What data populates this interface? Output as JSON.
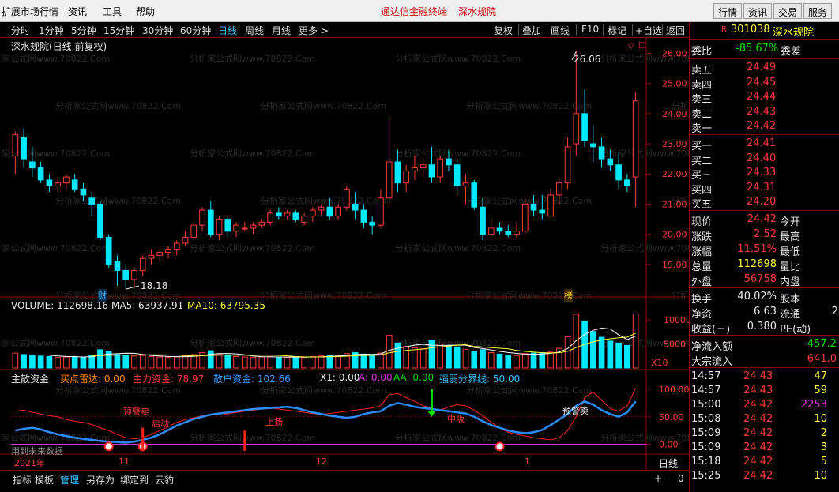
{
  "menu": {
    "left_items": [
      "扩展市场行情",
      "资讯",
      "工具",
      "帮助"
    ],
    "notice": "通达信金融终端",
    "notice2": "深水规院",
    "right_buttons": [
      "行情",
      "资讯",
      "交易",
      "服务"
    ]
  },
  "toolbar": {
    "periods": [
      "分时",
      "1分钟",
      "5分钟",
      "15分钟",
      "30分钟",
      "60分钟",
      "日线",
      "周线",
      "月线",
      "更多 >"
    ],
    "active_period": "日线",
    "right_buttons": [
      "复权",
      "叠加",
      "画线",
      "F10",
      "标记",
      "+自选",
      "返回"
    ]
  },
  "stock": {
    "title_label": "深水规院(日线,前复权)",
    "code": "301038",
    "name": "深水规院",
    "r_badge": "R"
  },
  "price_chart": {
    "y_ticks": [
      "26.00",
      "25.00",
      "24.00",
      "23.00",
      "22.00",
      "21.00",
      "20.00",
      "19.00"
    ],
    "high_annotation": "26.06",
    "low_annotation": "18.18",
    "marker_cai": "财",
    "marker_bang": "榜",
    "watermark": "分析家公式网www.70822.Com"
  },
  "volume_chart": {
    "volume_label": "VOLUME: 112698.16",
    "ma5_label": "MA5: 63937.91",
    "ma10_label": "MA10: 63795.35",
    "y_ticks": [
      "10000",
      "5000"
    ],
    "unit": "X10",
    "colors": {
      "up": "#ff3b3b",
      "down": "#00e8ff",
      "ma5": "#ffffff",
      "ma10": "#ffff3b"
    }
  },
  "indicator_chart": {
    "name": "主散资金",
    "buy_radar": "买点雷达: 0.00",
    "main_fund": "主力资金: 78.97",
    "retail_fund": "散户资金: 102.66",
    "x1": "X1: 0.00",
    "a": "A: 0.00",
    "aa": "AA: 0.00",
    "strong_weak": "强弱分界线: 50.00",
    "y_ticks": [
      "100.00",
      "50.00",
      "0.00"
    ],
    "annotations": {
      "warn_sell": "预警卖",
      "start": "启动",
      "rise": "上扬",
      "mid": "中阪",
      "warn_buy": "预警卖"
    },
    "future_data": "用到未来数据"
  },
  "xaxis": {
    "labels": [
      "2021年",
      "11",
      "12",
      "1"
    ],
    "period": "日线",
    "zoom": [
      "+",
      "-",
      "0"
    ]
  },
  "bottom": {
    "tabs": [
      "指标",
      "模板",
      "管理",
      "另存为",
      "绑定到",
      "云豹"
    ],
    "active_tab": "管理"
  },
  "quote": {
    "weibi": {
      "label": "委比",
      "value": "-85.67%",
      "label2": "委差"
    },
    "asks": [
      {
        "label": "卖五",
        "price": "24.49"
      },
      {
        "label": "卖四",
        "price": "24.45"
      },
      {
        "label": "卖三",
        "price": "24.44"
      },
      {
        "label": "卖二",
        "price": "24.43"
      },
      {
        "label": "卖一",
        "price": "24.42"
      }
    ],
    "bids": [
      {
        "label": "买一",
        "price": "24.41"
      },
      {
        "label": "买二",
        "price": "24.40"
      },
      {
        "label": "买三",
        "price": "24.33"
      },
      {
        "label": "买四",
        "price": "24.31"
      },
      {
        "label": "买五",
        "price": "24.20"
      }
    ],
    "stats": [
      {
        "l1": "现价",
        "v": "24.42",
        "l2": "今开",
        "vc": "red"
      },
      {
        "l1": "涨跌",
        "v": "2.52",
        "l2": "最高",
        "vc": "red"
      },
      {
        "l1": "涨幅",
        "v": "11.51%",
        "l2": "最低",
        "vc": "red"
      },
      {
        "l1": "总量",
        "v": "112698",
        "l2": "量比",
        "vc": "yellow"
      },
      {
        "l1": "外盘",
        "v": "56758",
        "l2": "内盘",
        "vc": "red"
      }
    ],
    "stats2": [
      {
        "l1": "换手",
        "v": "40.02%",
        "l2": "股本",
        "v2": ""
      },
      {
        "l1": "净资",
        "v": "6.63",
        "l2": "流通",
        "v2": "2"
      },
      {
        "l1": "收益(三)",
        "v": "0.380",
        "l2": "PE(动)",
        "v2": ""
      }
    ],
    "flows": [
      {
        "label": "净流入额",
        "value": "-457.2",
        "vc": "green"
      },
      {
        "label": "大宗流入",
        "value": "641.0",
        "vc": "red"
      }
    ],
    "ticks": [
      {
        "time": "14:57",
        "price": "24.43",
        "vol": "47",
        "vc": "yellow"
      },
      {
        "time": "14:57",
        "price": "24.43",
        "vol": "59",
        "vc": "yellow"
      },
      {
        "time": "15:00",
        "price": "24.42",
        "vol": "2253",
        "vc": "magenta"
      },
      {
        "time": "15:08",
        "price": "24.42",
        "vol": "10",
        "vc": "yellow"
      },
      {
        "time": "15:09",
        "price": "24.42",
        "vol": "2",
        "vc": "yellow"
      },
      {
        "time": "15:09",
        "price": "24.42",
        "vol": "3",
        "vc": "yellow"
      },
      {
        "time": "15:18",
        "price": "24.42",
        "vol": "5",
        "vc": "yellow"
      },
      {
        "time": "15:25",
        "price": "24.42",
        "vol": "10",
        "vc": "yellow"
      }
    ]
  },
  "candles": [
    [
      22.6,
      23.4,
      22.0,
      23.3
    ],
    [
      23.2,
      23.5,
      22.2,
      22.5
    ],
    [
      22.4,
      22.9,
      21.9,
      22.2
    ],
    [
      22.2,
      22.4,
      21.7,
      21.8
    ],
    [
      21.8,
      22.0,
      21.4,
      21.6
    ],
    [
      21.6,
      21.9,
      21.4,
      21.7
    ],
    [
      21.7,
      22.0,
      21.5,
      21.9
    ],
    [
      21.8,
      22.0,
      21.4,
      21.5
    ],
    [
      21.5,
      21.7,
      21.1,
      21.3
    ],
    [
      21.2,
      21.4,
      20.6,
      21.0
    ],
    [
      21.0,
      21.1,
      19.8,
      19.9
    ],
    [
      19.9,
      20.0,
      18.9,
      19.0
    ],
    [
      19.1,
      19.3,
      18.3,
      18.8
    ],
    [
      18.8,
      19.0,
      18.2,
      18.5
    ],
    [
      18.5,
      18.9,
      18.2,
      18.8
    ],
    [
      18.8,
      19.3,
      18.6,
      19.2
    ],
    [
      19.2,
      19.5,
      19.0,
      19.3
    ],
    [
      19.3,
      19.5,
      19.1,
      19.4
    ],
    [
      19.4,
      19.6,
      19.2,
      19.5
    ],
    [
      19.5,
      19.8,
      19.3,
      19.7
    ],
    [
      19.7,
      20.1,
      19.6,
      19.9
    ],
    [
      19.9,
      20.4,
      19.8,
      20.3
    ],
    [
      20.3,
      20.9,
      20.1,
      20.8
    ],
    [
      20.8,
      21.1,
      19.9,
      20.0
    ],
    [
      20.0,
      20.6,
      19.8,
      20.5
    ],
    [
      20.5,
      20.6,
      19.9,
      20.1
    ],
    [
      20.1,
      20.4,
      19.9,
      20.3
    ],
    [
      20.2,
      20.4,
      20.1,
      20.2
    ],
    [
      20.2,
      20.4,
      20.0,
      20.3
    ],
    [
      20.3,
      20.5,
      20.2,
      20.4
    ],
    [
      20.4,
      20.8,
      20.3,
      20.7
    ],
    [
      20.7,
      20.9,
      20.5,
      20.6
    ],
    [
      20.6,
      20.8,
      20.5,
      20.7
    ],
    [
      20.7,
      20.8,
      20.4,
      20.5
    ],
    [
      20.4,
      20.7,
      20.3,
      20.6
    ],
    [
      20.6,
      20.9,
      20.4,
      20.8
    ],
    [
      20.8,
      21.0,
      20.6,
      20.9
    ],
    [
      20.9,
      21.2,
      20.5,
      20.6
    ],
    [
      20.6,
      21.0,
      20.5,
      20.9
    ],
    [
      20.9,
      21.6,
      20.8,
      21.5
    ],
    [
      21.0,
      21.4,
      20.5,
      20.8
    ],
    [
      20.8,
      21.0,
      20.2,
      20.4
    ],
    [
      20.4,
      20.6,
      20.0,
      20.3
    ],
    [
      20.3,
      21.5,
      20.2,
      21.2
    ],
    [
      21.2,
      23.9,
      21.0,
      22.4
    ],
    [
      22.4,
      22.8,
      21.4,
      21.7
    ],
    [
      21.7,
      22.3,
      21.4,
      22.1
    ],
    [
      22.1,
      22.6,
      21.8,
      22.2
    ],
    [
      22.2,
      22.5,
      21.9,
      22.3
    ],
    [
      22.3,
      22.9,
      21.7,
      21.9
    ],
    [
      21.9,
      22.6,
      21.7,
      22.5
    ],
    [
      22.5,
      22.8,
      22.1,
      22.3
    ],
    [
      22.3,
      22.5,
      21.3,
      21.6
    ],
    [
      21.6,
      22.0,
      21.0,
      21.7
    ],
    [
      21.7,
      21.8,
      20.8,
      20.9
    ],
    [
      20.9,
      21.2,
      19.8,
      20.0
    ],
    [
      20.0,
      20.5,
      19.9,
      20.2
    ],
    [
      20.2,
      20.4,
      20.0,
      20.1
    ],
    [
      20.1,
      20.3,
      19.9,
      20.0
    ],
    [
      20.0,
      20.4,
      19.9,
      20.1
    ],
    [
      20.1,
      21.2,
      20.0,
      21.0
    ],
    [
      21.0,
      21.3,
      20.6,
      20.8
    ],
    [
      20.8,
      21.3,
      20.5,
      20.7
    ],
    [
      20.6,
      21.5,
      20.6,
      21.3
    ],
    [
      21.3,
      21.9,
      21.0,
      21.7
    ],
    [
      21.7,
      23.2,
      21.5,
      22.9
    ],
    [
      23.0,
      26.1,
      22.6,
      24.0
    ],
    [
      24.0,
      24.8,
      22.9,
      23.1
    ],
    [
      23.0,
      23.6,
      22.4,
      22.9
    ],
    [
      22.9,
      23.2,
      22.2,
      22.5
    ],
    [
      22.5,
      22.8,
      22.1,
      22.3
    ],
    [
      22.3,
      22.7,
      21.5,
      21.8
    ],
    [
      21.8,
      22.0,
      21.4,
      21.6
    ],
    [
      21.9,
      24.7,
      20.9,
      24.42
    ]
  ],
  "volumes": [
    3100,
    2800,
    2600,
    2500,
    2400,
    2200,
    2300,
    2400,
    2200,
    2600,
    3800,
    3500,
    2800,
    2700,
    2500,
    2600,
    2400,
    2300,
    2200,
    2300,
    2500,
    2800,
    3200,
    3600,
    2900,
    2600,
    2400,
    2300,
    2200,
    2300,
    2400,
    2300,
    2200,
    2300,
    2200,
    2400,
    2500,
    2700,
    2600,
    3000,
    3200,
    2900,
    2500,
    3100,
    6800,
    5200,
    4500,
    4200,
    4000,
    5800,
    5000,
    4600,
    4400,
    3900,
    3500,
    3800,
    3200,
    2900,
    2700,
    2600,
    3000,
    3100,
    3200,
    3300,
    4100,
    6500,
    11200,
    9800,
    7600,
    6400,
    5600,
    5200,
    4700,
    11269
  ],
  "indicator": {
    "main": [
      25,
      28,
      30,
      27,
      22,
      18,
      15,
      12,
      10,
      8,
      6,
      5,
      4,
      3,
      5,
      8,
      12,
      18,
      26,
      34,
      40,
      46,
      50,
      54,
      56,
      58,
      60,
      62,
      64,
      65,
      66,
      67,
      68,
      66,
      62,
      58,
      55,
      52,
      50,
      48,
      50,
      55,
      58,
      60,
      70,
      75,
      72,
      68,
      66,
      64,
      62,
      60,
      58,
      56,
      50,
      42,
      35,
      30,
      25,
      22,
      20,
      22,
      26,
      35,
      45,
      55,
      70,
      78,
      72,
      62,
      55,
      50,
      58,
      78
    ],
    "retail": [
      60,
      62,
      58,
      55,
      52,
      50,
      45,
      42,
      40,
      36,
      30,
      25,
      18,
      12,
      10,
      12,
      18,
      25,
      32,
      40,
      45,
      48,
      52,
      54,
      56,
      55,
      58,
      60,
      62,
      64,
      66,
      64,
      62,
      60,
      58,
      56,
      54,
      56,
      58,
      60,
      62,
      64,
      66,
      70,
      90,
      92,
      85,
      78,
      70,
      65,
      62,
      68,
      72,
      70,
      62,
      52,
      40,
      30,
      22,
      18,
      15,
      12,
      10,
      8,
      12,
      25,
      50,
      85,
      95,
      80,
      65,
      60,
      70,
      102
    ]
  }
}
